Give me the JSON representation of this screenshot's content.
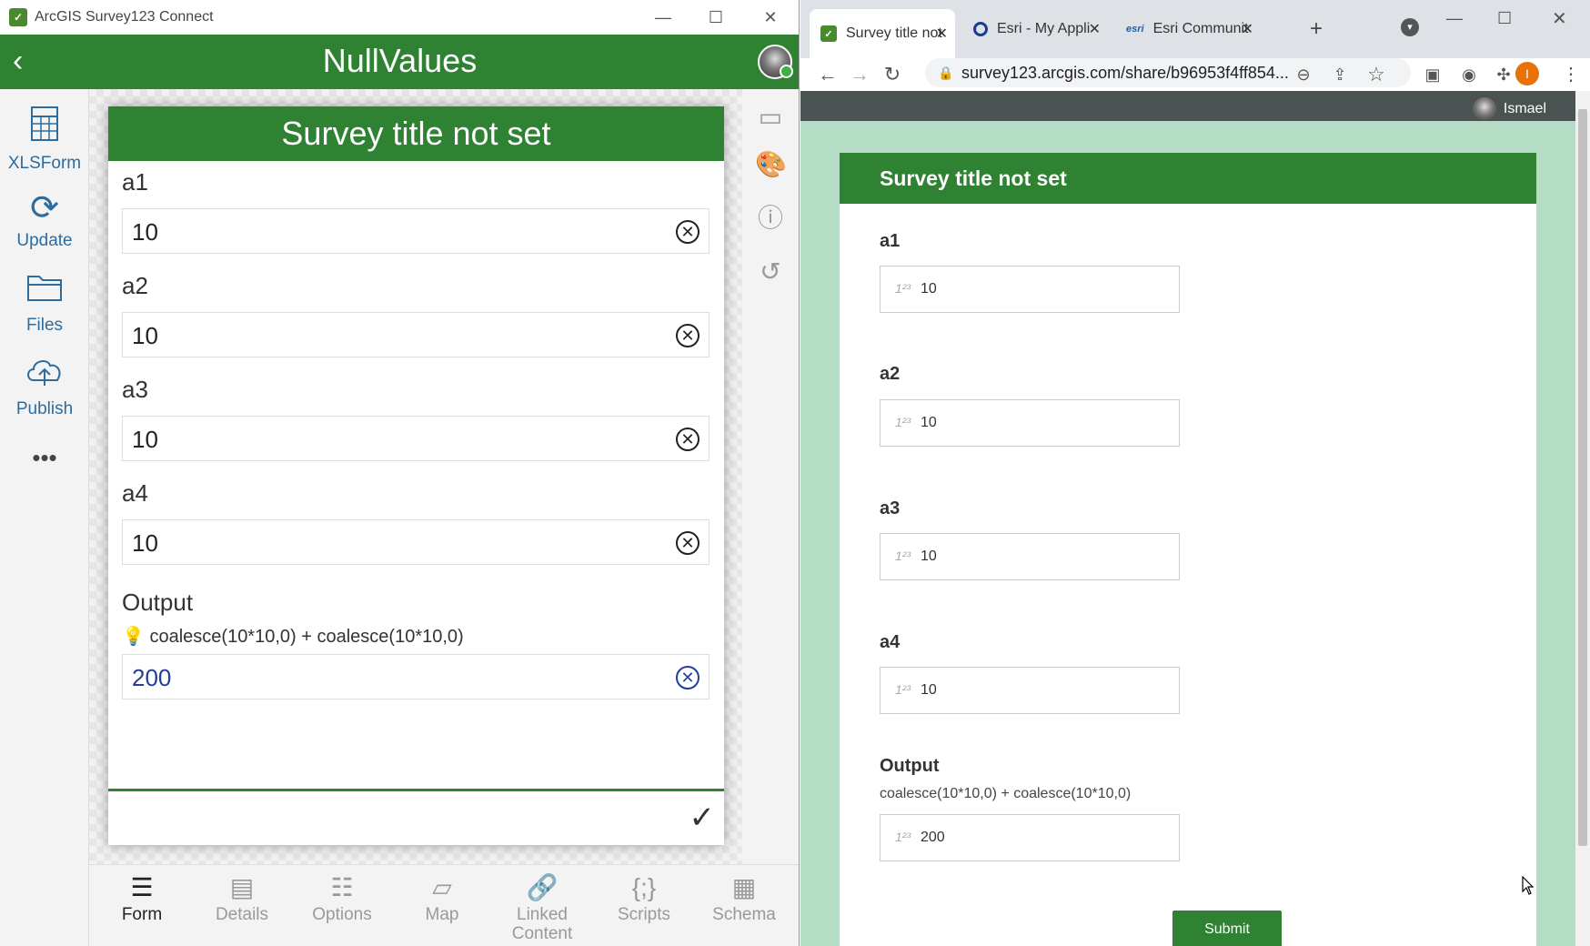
{
  "left_app": {
    "window_title": "ArcGIS Survey123 Connect",
    "header_title": "NullValues",
    "sidebar": [
      {
        "label": "XLSForm",
        "icon": "spreadsheet-icon"
      },
      {
        "label": "Update",
        "icon": "refresh-icon"
      },
      {
        "label": "Files",
        "icon": "folder-icon"
      },
      {
        "label": "Publish",
        "icon": "cloud-upload-icon"
      },
      {
        "label": "•••",
        "icon": "more-icon"
      }
    ],
    "form": {
      "title": "Survey title not set",
      "fields": [
        {
          "label": "a1",
          "value": "10"
        },
        {
          "label": "a2",
          "value": "10"
        },
        {
          "label": "a3",
          "value": "10"
        },
        {
          "label": "a4",
          "value": "10"
        }
      ],
      "output": {
        "label": "Output",
        "hint": "coalesce(10*10,0) + coalesce(10*10,0)",
        "value": "200"
      }
    },
    "bottom_tabs": [
      {
        "label": "Form",
        "active": true
      },
      {
        "label": "Details"
      },
      {
        "label": "Options"
      },
      {
        "label": "Map"
      },
      {
        "label": "Linked Content"
      },
      {
        "label": "Scripts"
      },
      {
        "label": "Schema"
      }
    ]
  },
  "browser": {
    "tabs": [
      {
        "title": "Survey title not",
        "active": true
      },
      {
        "title": "Esri - My Appli"
      },
      {
        "title": "Esri Communit",
        "fav": "esri"
      }
    ],
    "url": "survey123.arcgis.com/share/b96953f4ff854...",
    "profile_initial": "I",
    "page": {
      "user_name": "Ismael",
      "title": "Survey title not set",
      "fields": [
        {
          "label": "a1",
          "value": "10"
        },
        {
          "label": "a2",
          "value": "10"
        },
        {
          "label": "a3",
          "value": "10"
        },
        {
          "label": "a4",
          "value": "10"
        }
      ],
      "output": {
        "label": "Output",
        "hint": "coalesce(10*10,0) + coalesce(10*10,0)",
        "value": "200"
      },
      "submit_label": "Submit"
    }
  },
  "colors": {
    "survey_green": "#2e8232",
    "page_background": "#b5dcc4",
    "output_value_blue": "#213f9a"
  }
}
